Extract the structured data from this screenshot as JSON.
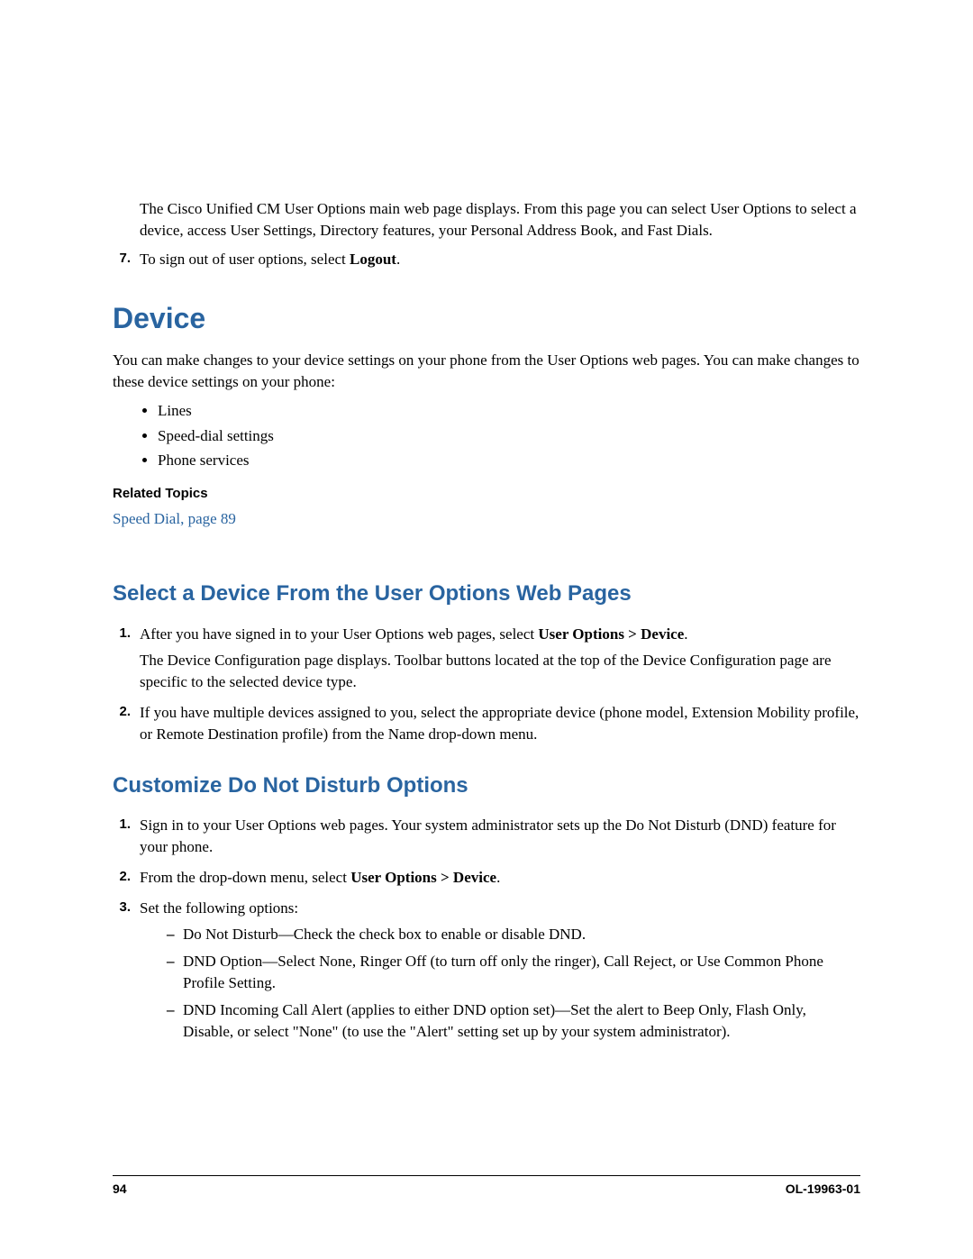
{
  "intro": {
    "para": "The Cisco Unified CM User Options main web page displays. From this page you can select User Options to select a device, access User Settings, Directory features, your Personal Address Book, and Fast Dials.",
    "step7_number": "7.",
    "step7_prefix": "To sign out of user options, select ",
    "step7_bold": "Logout",
    "step7_suffix": "."
  },
  "device": {
    "heading": "Device",
    "intro": "You can make changes to your device settings on your phone from the User Options web pages. You can make changes to these device settings on your phone:",
    "bullets": [
      "Lines",
      "Speed-dial settings",
      "Phone services"
    ],
    "related_label": "Related Topics",
    "related_link": "Speed Dial, page 89"
  },
  "select_device": {
    "heading": "Select a Device From the User Options Web Pages",
    "step1_number": "1.",
    "step1_prefix": "After you have signed in to your User Options web pages, select ",
    "step1_bold": "User Options > Device",
    "step1_suffix": ".",
    "step1_sub": "The Device Configuration page displays. Toolbar buttons located at the top of the Device Configuration page are specific to the selected device type.",
    "step2_number": "2.",
    "step2_text": "If you have multiple devices assigned to you, select the appropriate device (phone model, Extension Mobility profile, or Remote Destination profile) from the Name drop-down menu."
  },
  "dnd": {
    "heading": "Customize Do Not Disturb Options",
    "step1_number": "1.",
    "step1_text": "Sign in to your User Options web pages. Your system administrator sets up the Do Not Disturb (DND) feature for your phone.",
    "step2_number": "2.",
    "step2_prefix": "From the drop-down menu, select ",
    "step2_bold": "User Options > Device",
    "step2_suffix": ".",
    "step3_number": "3.",
    "step3_text": "Set the following options:",
    "dashes": [
      "Do Not Disturb—Check the check box to enable or disable DND.",
      "DND Option—Select None, Ringer Off (to turn off only the ringer), Call Reject, or Use Common Phone Profile Setting.",
      "DND Incoming Call Alert (applies to either DND option set)—Set the alert to Beep Only, Flash Only, Disable, or select \"None\" (to use the \"Alert\" setting set up by your system administrator)."
    ]
  },
  "footer": {
    "page": "94",
    "docid": "OL-19963-01"
  }
}
